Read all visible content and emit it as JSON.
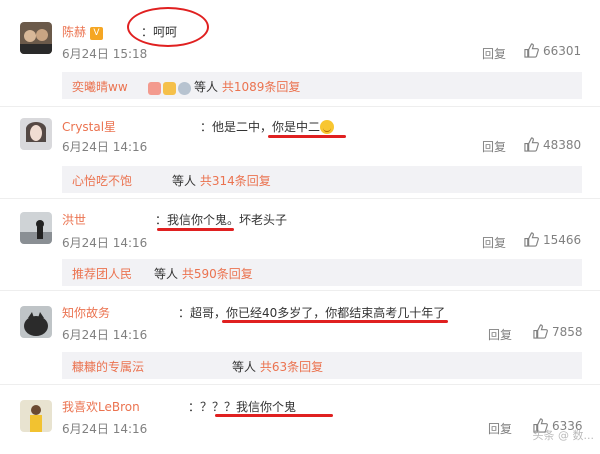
{
  "reply_label": "回复",
  "others_label": "等人",
  "comments": [
    {
      "user": "陈赫",
      "vip": "V",
      "text": "：呵呵",
      "time": "6月24日 15:18",
      "likes": "66301",
      "sub": {
        "user": "奕曦晴ww",
        "count": "共1089条回复"
      }
    },
    {
      "user": "Crystal星",
      "text": "：他是二中，你是中二",
      "time": "6月24日 14:16",
      "likes": "48380",
      "sub": {
        "user": "心怡吃不饱",
        "count": "共314条回复"
      }
    },
    {
      "user": "洪世",
      "text": "：我信你个鬼。坏老头子",
      "time": "6月24日 14:16",
      "likes": "15466",
      "sub": {
        "user": "推荐团人民",
        "count": "共590条回复"
      }
    },
    {
      "user": "知你故务",
      "text": "：超哥，你已经40多岁了，你都结束高考几十年了",
      "time": "6月24日 14:16",
      "likes": "7858",
      "sub": {
        "user": "糠糠的专属沄",
        "count": "共63条回复"
      }
    },
    {
      "user": "我喜欢LeBron",
      "text": "：？？？我信你个鬼",
      "time": "6月24日 14:16",
      "likes": "6336"
    }
  ],
  "watermark": "头条 @ 数...",
  "colors": {
    "username": "#eb7350",
    "annotation": "#e02020",
    "subbar": "#f2f2f5"
  }
}
